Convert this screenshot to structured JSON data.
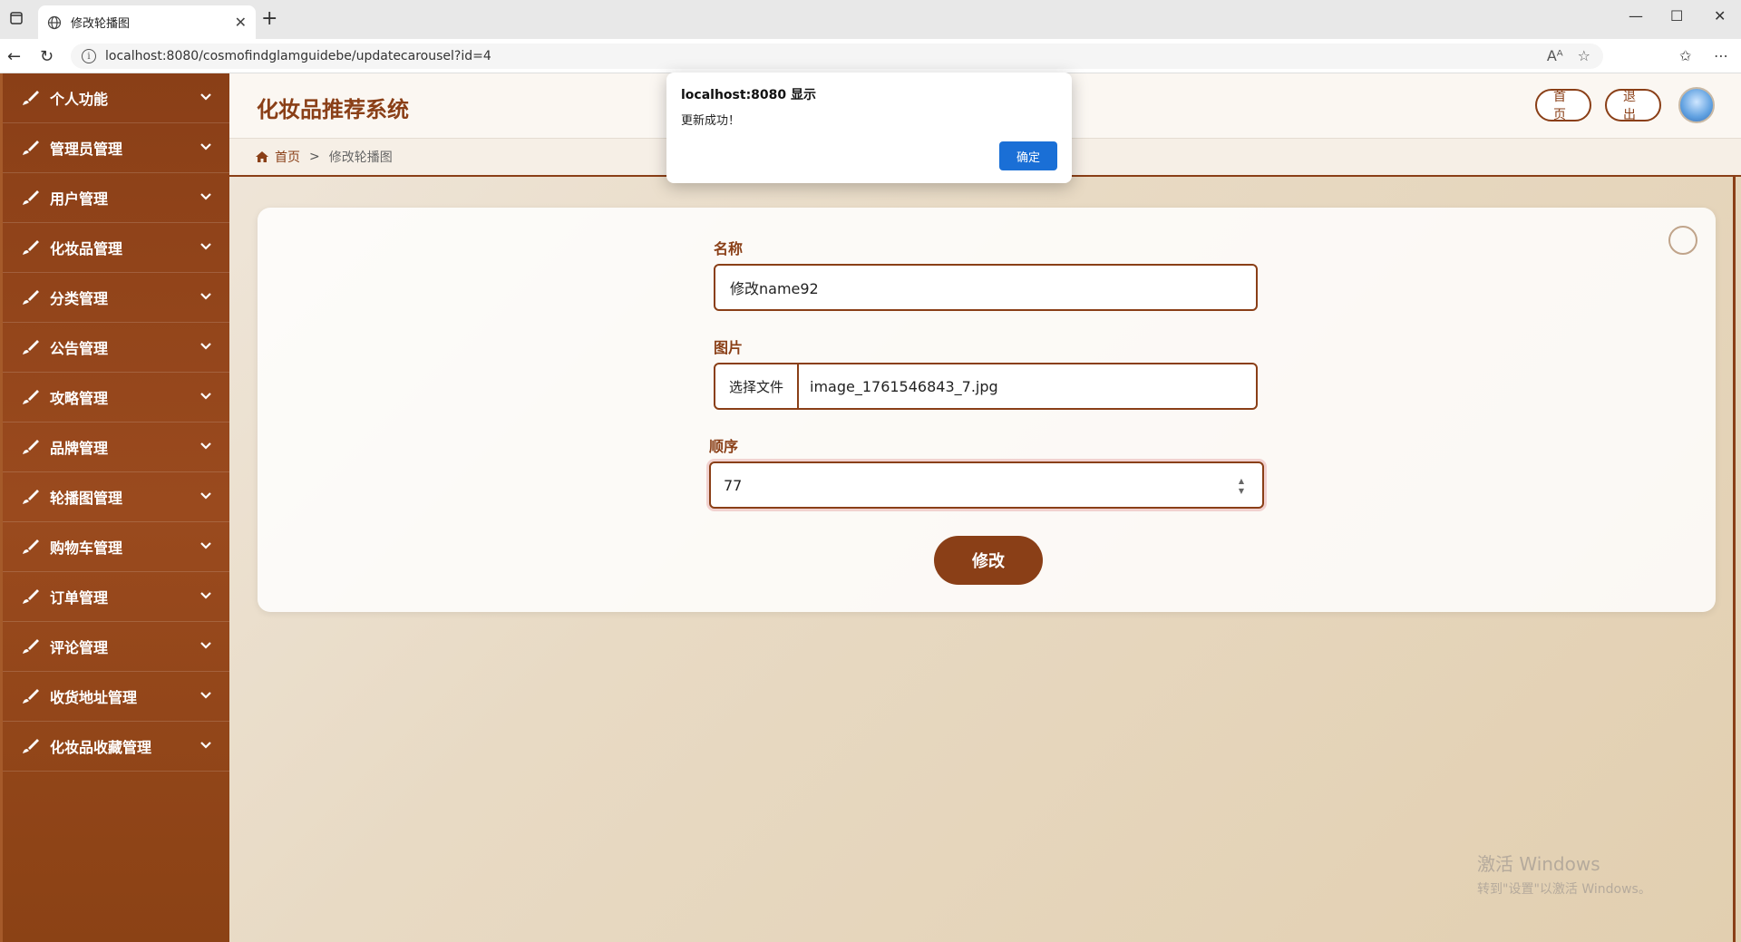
{
  "browser": {
    "tab_title": "修改轮播图",
    "url": "localhost:8080/cosmofindglamguidebe/updatecarousel?id=4"
  },
  "sidebar": {
    "items": [
      {
        "label": "个人功能"
      },
      {
        "label": "管理员管理"
      },
      {
        "label": "用户管理"
      },
      {
        "label": "化妆品管理"
      },
      {
        "label": "分类管理"
      },
      {
        "label": "公告管理"
      },
      {
        "label": "攻略管理"
      },
      {
        "label": "品牌管理"
      },
      {
        "label": "轮播图管理"
      },
      {
        "label": "购物车管理"
      },
      {
        "label": "订单管理"
      },
      {
        "label": "评论管理"
      },
      {
        "label": "收货地址管理"
      },
      {
        "label": "化妆品收藏管理"
      }
    ]
  },
  "header": {
    "title": "化妆品推荐系统",
    "home_label": "首页",
    "logout_label": "退出"
  },
  "breadcrumb": {
    "home": "首页",
    "separator": ">",
    "current": "修改轮播图"
  },
  "form": {
    "name_label": "名称",
    "name_value": "修改name92",
    "image_label": "图片",
    "choose_file": "选择文件",
    "file_name": "image_1761546843_7.jpg",
    "order_label": "顺序",
    "order_value": "77",
    "submit_label": "修改"
  },
  "dialog": {
    "title": "localhost:8080 显示",
    "message": "更新成功！",
    "ok_label": "确定"
  },
  "watermark": {
    "line1": "激活 Windows",
    "line2": "转到\"设置\"以激活 Windows。"
  },
  "colors": {
    "brand": "#8a3f17",
    "dialog_button": "#1a6fd6"
  }
}
